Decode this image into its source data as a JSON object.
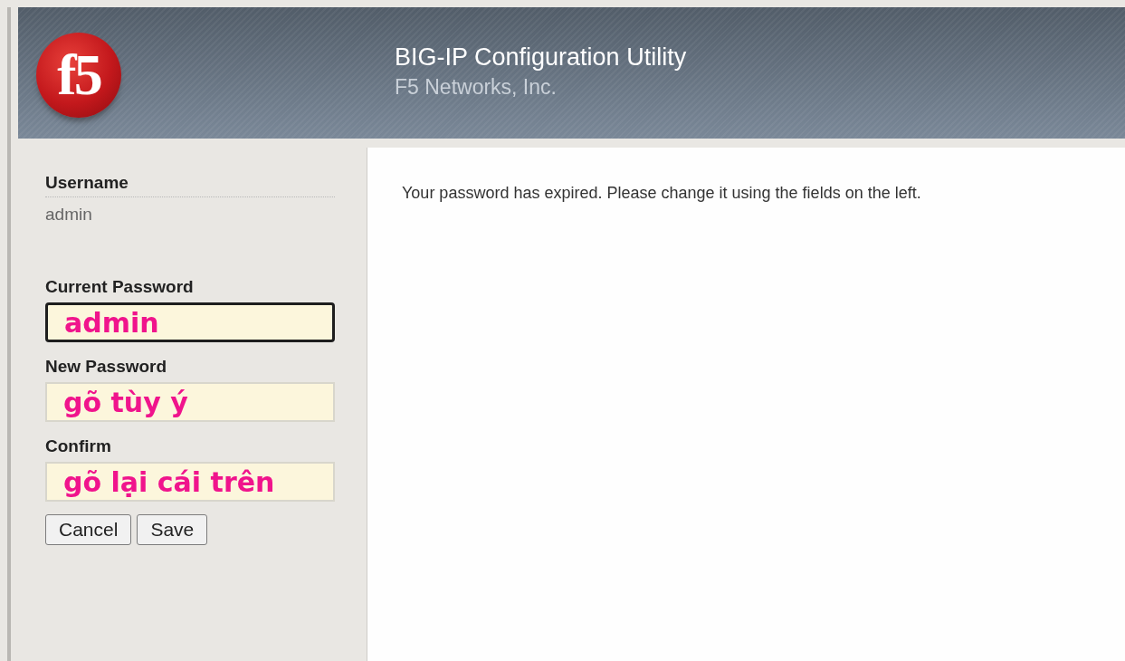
{
  "header": {
    "logo_text": "f5",
    "title": "BIG-IP Configuration Utility",
    "subtitle": "F5 Networks, Inc."
  },
  "username": {
    "label": "Username",
    "value": "admin"
  },
  "fields": [
    {
      "label": "Current Password",
      "value": "admin",
      "focused": true
    },
    {
      "label": "New Password",
      "value": "gõ tùy ý",
      "focused": false
    },
    {
      "label": "Confirm",
      "value": "gõ lại cái trên",
      "focused": false
    }
  ],
  "buttons": [
    "Cancel",
    "Save"
  ],
  "message": "Your password has expired. Please change it using the fields on the left."
}
